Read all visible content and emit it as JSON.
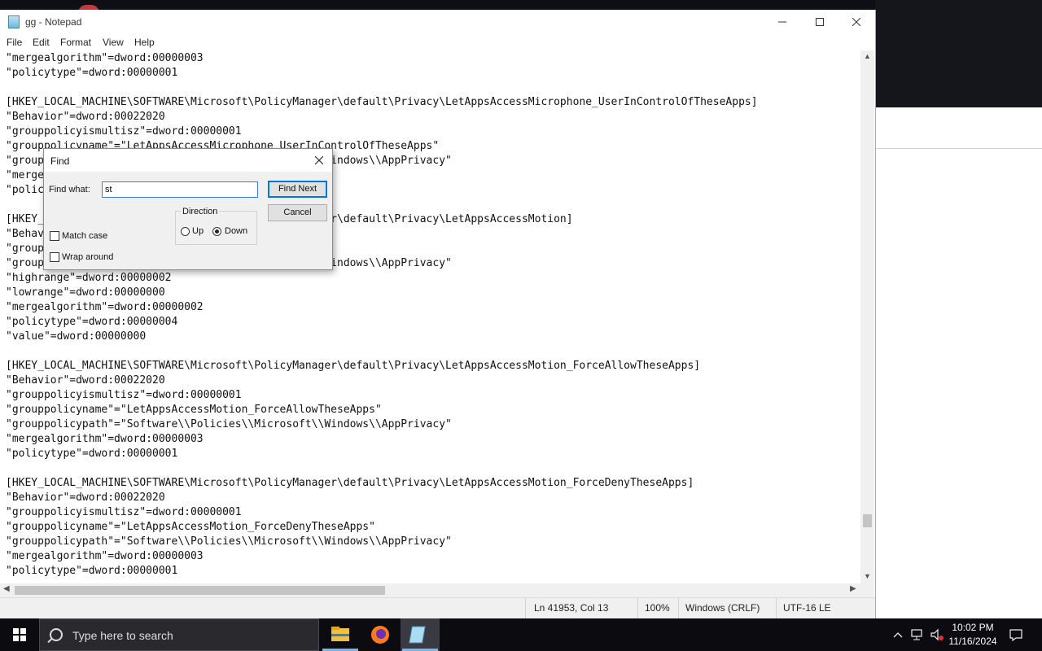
{
  "window": {
    "title": "gg - Notepad",
    "menu": [
      "File",
      "Edit",
      "Format",
      "View",
      "Help"
    ],
    "minimize_icon": "minimize-icon",
    "maximize_icon": "maximize-icon",
    "close_icon": "close-icon"
  },
  "editor": {
    "lines": [
      "\"mergealgorithm\"=dword:00000003",
      "\"policytype\"=dword:00000001",
      "",
      "[HKEY_LOCAL_MACHINE\\SOFTWARE\\Microsoft\\PolicyManager\\default\\Privacy\\LetAppsAccessMicrophone_UserInControlOfTheseApps]",
      "\"Behavior\"=dword:00022020",
      "\"grouppolicyismultisz\"=dword:00000001",
      "\"grouppolicyname\"=\"LetAppsAccessMicrophone_UserInControlOfTheseApps\"",
      "\"grouppolicypath\"=\"Software\\\\Policies\\\\Microsoft\\\\Windows\\\\AppPrivacy\"",
      "\"mergealgorithm\"=dword:00000003",
      "\"policytype\"=dword:00000001",
      "",
      "[HKEY_LOCAL_MACHINE\\SOFTWARE\\Microsoft\\PolicyManager\\default\\Privacy\\LetAppsAccessMotion]",
      "\"Behavior\"=dword:00022020",
      "\"grouppolicyismultisz\"=dword:00000001",
      "\"grouppolicypath\"=\"Software\\\\Policies\\\\Microsoft\\\\Windows\\\\AppPrivacy\"",
      "\"highrange\"=dword:00000002",
      "\"lowrange\"=dword:00000000",
      "\"mergealgorithm\"=dword:00000002",
      "\"policytype\"=dword:00000004",
      "\"value\"=dword:00000000",
      "",
      "[HKEY_LOCAL_MACHINE\\SOFTWARE\\Microsoft\\PolicyManager\\default\\Privacy\\LetAppsAccessMotion_ForceAllowTheseApps]",
      "\"Behavior\"=dword:00022020",
      "\"grouppolicyismultisz\"=dword:00000001",
      "\"grouppolicyname\"=\"LetAppsAccessMotion_ForceAllowTheseApps\"",
      "\"grouppolicypath\"=\"Software\\\\Policies\\\\Microsoft\\\\Windows\\\\AppPrivacy\"",
      "\"mergealgorithm\"=dword:00000003",
      "\"policytype\"=dword:00000001",
      "",
      "[HKEY_LOCAL_MACHINE\\SOFTWARE\\Microsoft\\PolicyManager\\default\\Privacy\\LetAppsAccessMotion_ForceDenyTheseApps]",
      "\"Behavior\"=dword:00022020",
      "\"grouppolicyismultisz\"=dword:00000001",
      "\"grouppolicyname\"=\"LetAppsAccessMotion_ForceDenyTheseApps\"",
      "\"grouppolicypath\"=\"Software\\\\Policies\\\\Microsoft\\\\Windows\\\\AppPrivacy\"",
      "\"mergealgorithm\"=dword:00000003",
      "\"policytype\"=dword:00000001"
    ]
  },
  "statusbar": {
    "position": "Ln 41953, Col 13",
    "zoom": "100%",
    "line_ending": "Windows (CRLF)",
    "encoding": "UTF-16 LE"
  },
  "find_dialog": {
    "title": "Find",
    "find_what_label": "Find what:",
    "find_what_value": "st",
    "find_next_label": "Find Next",
    "cancel_label": "Cancel",
    "direction_label": "Direction",
    "up_label": "Up",
    "down_label": "Down",
    "direction_selected": "Down",
    "match_case_label": "Match case",
    "match_case_checked": false,
    "wrap_around_label": "Wrap around",
    "wrap_around_checked": false
  },
  "taskbar": {
    "search_placeholder": "Type here to search",
    "apps": [
      "file-explorer-icon",
      "firefox-icon",
      "notepad-icon"
    ],
    "time": "10:02 PM",
    "date": "11/16/2024"
  },
  "colors": {
    "accent": "#0078d7",
    "taskbar": "#0c0c10"
  }
}
